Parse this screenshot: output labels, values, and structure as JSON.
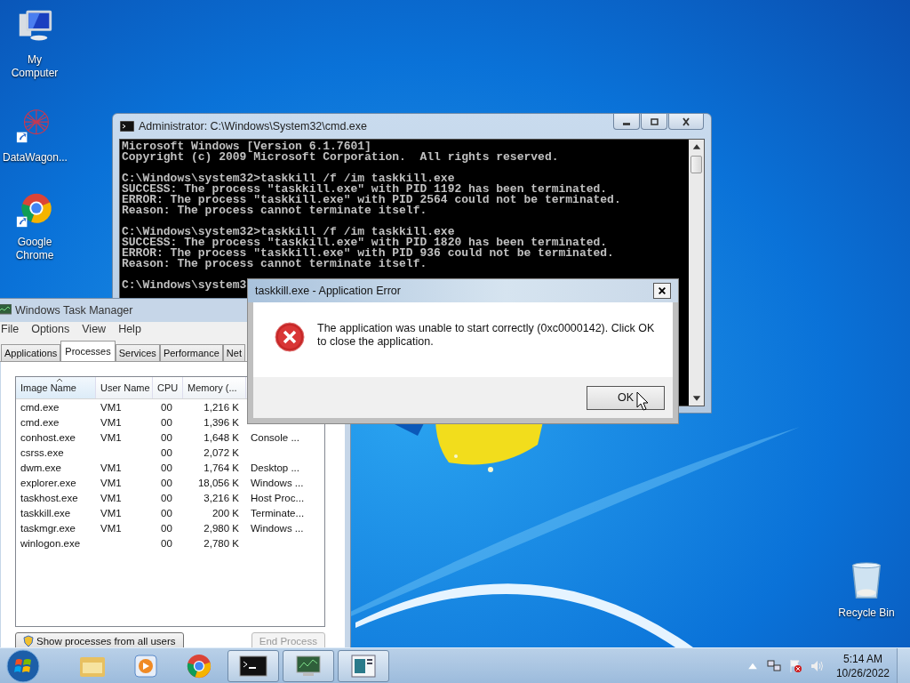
{
  "desktop_icons": [
    {
      "kind": "computer",
      "label": "My Computer"
    },
    {
      "kind": "datawagon",
      "label": "DataWagon..."
    },
    {
      "kind": "chrome",
      "label": "Google Chrome"
    }
  ],
  "recycle_bin": {
    "kind": "recycle",
    "label": "Recycle Bin"
  },
  "cmd_window": {
    "title": "Administrator: C:\\Windows\\System32\\cmd.exe",
    "blocks": [
      [
        "Microsoft Windows [Version 6.1.7601]",
        "Copyright (c) 2009 Microsoft Corporation.  All rights reserved."
      ],
      [
        "C:\\Windows\\system32>taskkill /f /im taskkill.exe",
        "SUCCESS: The process \"taskkill.exe\" with PID 1192 has been terminated.",
        "ERROR: The process \"taskkill.exe\" with PID 2564 could not be terminated.",
        "Reason: The process cannot terminate itself."
      ],
      [
        "C:\\Windows\\system32>taskkill /f /im taskkill.exe",
        "SUCCESS: The process \"taskkill.exe\" with PID 1820 has been terminated.",
        "ERROR: The process \"taskkill.exe\" with PID 936 could not be terminated.",
        "Reason: The process cannot terminate itself."
      ],
      [
        "C:\\Windows\\system3"
      ]
    ]
  },
  "task_manager": {
    "title": "Windows Task Manager",
    "menu": [
      "File",
      "Options",
      "View",
      "Help"
    ],
    "tabs": [
      {
        "label": "Applications",
        "selected": false
      },
      {
        "label": "Processes",
        "selected": true
      },
      {
        "label": "Services",
        "selected": false
      },
      {
        "label": "Performance",
        "selected": false
      },
      {
        "label": "Net",
        "selected": false
      }
    ],
    "columns": [
      {
        "label": "Image Name",
        "sorted": true
      },
      {
        "label": "User Name",
        "sorted": false
      },
      {
        "label": "CPU",
        "sorted": false
      },
      {
        "label": "Memory (...",
        "sorted": false
      }
    ],
    "rows": [
      {
        "image_name": "cmd.exe",
        "user_name": "VM1",
        "cpu": "00",
        "memory": "1,216 K"
      },
      {
        "image_name": "cmd.exe",
        "user_name": "VM1",
        "cpu": "00",
        "memory": "1,396 K"
      },
      {
        "image_name": "conhost.exe",
        "user_name": "VM1",
        "cpu": "00",
        "memory": "1,648 K",
        "column_5": "Console ..."
      },
      {
        "image_name": "csrss.exe",
        "cpu": "00",
        "memory": "2,072 K"
      },
      {
        "image_name": "dwm.exe",
        "user_name": "VM1",
        "cpu": "00",
        "memory": "1,764 K",
        "column_5": "Desktop ..."
      },
      {
        "image_name": "explorer.exe",
        "user_name": "VM1",
        "cpu": "00",
        "memory": "18,056 K",
        "column_5": "Windows ..."
      },
      {
        "image_name": "taskhost.exe",
        "user_name": "VM1",
        "cpu": "00",
        "memory": "3,216 K",
        "column_5": "Host Proc..."
      },
      {
        "image_name": "taskkill.exe",
        "user_name": "VM1",
        "cpu": "00",
        "memory": "200 K",
        "column_5": "Terminate..."
      },
      {
        "image_name": "taskmgr.exe",
        "user_name": "VM1",
        "cpu": "00",
        "memory": "2,980 K",
        "column_5": "Windows ..."
      },
      {
        "image_name": "winlogon.exe",
        "cpu": "00",
        "memory": "2,780 K"
      }
    ],
    "buttons": [
      {
        "label": "Show processes from all users",
        "disabled": false
      },
      {
        "label": "End Process",
        "disabled": true
      }
    ]
  },
  "dialog": {
    "title": "taskkill.exe - Application Error",
    "message": "The application was unable to start correctly (0xc0000142). Click OK to close the application.",
    "button": "OK"
  },
  "taskbar": {
    "items": [
      {
        "kind": "explorer",
        "running": false
      },
      {
        "kind": "media",
        "running": false
      },
      {
        "kind": "chrome",
        "running": false
      },
      {
        "kind": "cmd",
        "running": true
      },
      {
        "kind": "taskmgr",
        "running": true
      },
      {
        "kind": "window",
        "running": true
      }
    ],
    "time": "5:14 AM",
    "date": "10/26/2022"
  }
}
